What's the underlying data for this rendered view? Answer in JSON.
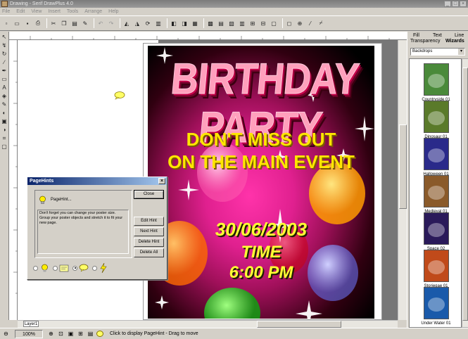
{
  "window": {
    "title": "Drawing - Serif DrawPlus 4.0"
  },
  "menu": [
    "File",
    "Edit",
    "View",
    "Insert",
    "Tools",
    "Arrange",
    "Help"
  ],
  "toolbar_icons": [
    "new-icon",
    "open-icon",
    "save-icon",
    "print-icon",
    "cut-icon",
    "copy-icon",
    "paste-icon",
    "undo-icon",
    "redo-icon"
  ],
  "poster": {
    "headline": "BIRTHDAY PARTY",
    "line1": "DON'T MISS OUT",
    "line2": "ON THE MAIN EVENT",
    "date": "30/06/2003",
    "time_label": "TIME",
    "time_value": "6:00 PM",
    "colors": {
      "headline": "#ff9fb6",
      "tagline": "#ffe600",
      "details": "#ffff33",
      "background": "#e0208f"
    }
  },
  "page_hints": {
    "title": "PageHints",
    "heading": "PageHint...",
    "body": "Don't forget you can change your poster size. Group your poster objects and stretch it to fit your new page.",
    "buttons": {
      "close": "Close",
      "edit": "Edit Hint",
      "next": "Next Hint",
      "delete": "Delete Hint",
      "delete_all": "Delete All"
    }
  },
  "side_panel": {
    "tabs": {
      "fill": "Fill",
      "text": "Text",
      "line": "Line",
      "transparency": "Transparency",
      "wizards": "Wizards"
    },
    "category": "Backdrops",
    "items": [
      {
        "label": "Countryside 01",
        "color": "#4a8a3a"
      },
      {
        "label": "Dinosaur 01",
        "color": "#5a7a2a"
      },
      {
        "label": "Halloween 01",
        "color": "#2a2a8a"
      },
      {
        "label": "Medieval 01",
        "color": "#8a5a2a"
      },
      {
        "label": "Space 02",
        "color": "#2a1a5a"
      },
      {
        "label": "Storiegae 01",
        "color": "#c04a1a"
      },
      {
        "label": "Under Water 01",
        "color": "#1a5aaa"
      }
    ]
  },
  "layer_tab": "Layer1",
  "status": {
    "zoom": "100%",
    "hint": "Click to display PageHint - Drag to move"
  }
}
